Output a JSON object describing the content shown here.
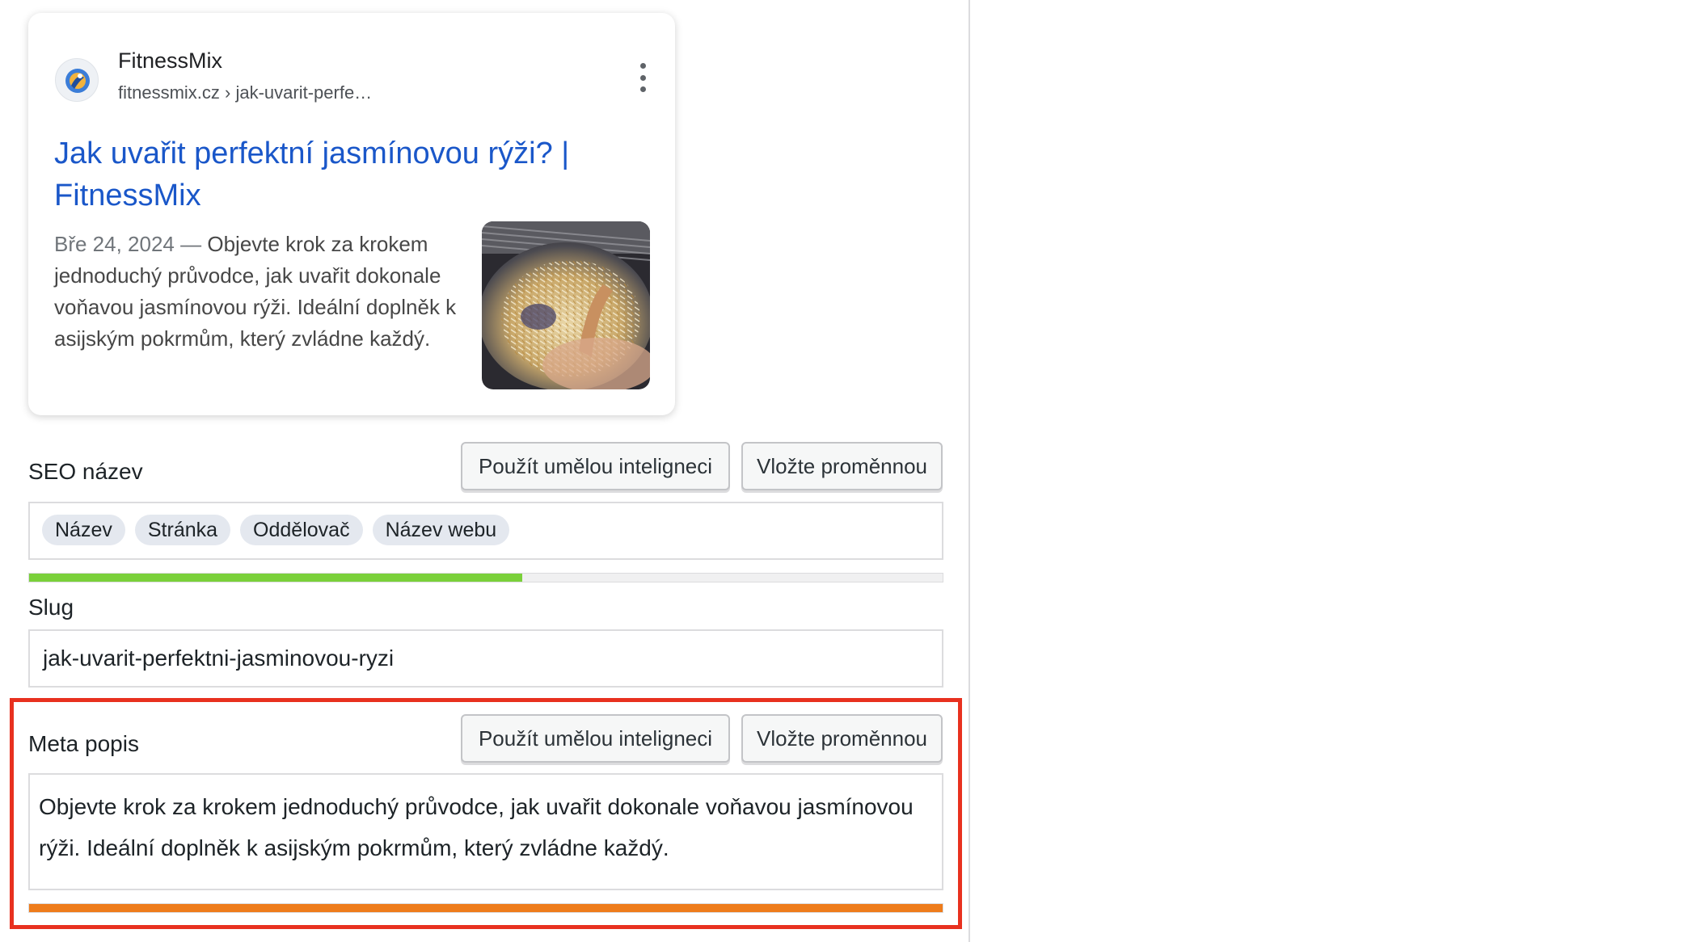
{
  "preview": {
    "site_name": "FitnessMix",
    "site_url": "fitnessmix.cz › jak-uvarit-perfe…",
    "title": "Jak uvařit perfektní jasmínovou rýži? | FitnessMix",
    "date": "Bře 24, 2024",
    "separator": "—",
    "snippet": "Objevte krok za krokem jednoduchý průvodce, jak uvařit dokonale voňavou jasmínovou rýži. Ideální doplněk k asijským pokrmům, který zvládne každý."
  },
  "seo_title": {
    "label": "SEO název",
    "ai_button": "Použít umělou inteligneci",
    "variable_button": "Vložte proměnnou",
    "chips": [
      "Název",
      "Stránka",
      "Oddělovač",
      "Název webu"
    ],
    "progress": 0.54,
    "progress_color": "#7ad03a"
  },
  "slug": {
    "label": "Slug",
    "value": "jak-uvarit-perfektni-jasminovou-ryzi"
  },
  "meta_description": {
    "label": "Meta popis",
    "ai_button": "Použít umělou inteligneci",
    "variable_button": "Vložte proměnnou",
    "value": "Objevte krok za krokem jednoduchý průvodce, jak uvařit dokonale voňavou jasmínovou rýži. Ideální doplněk k asijským pokrmům, který zvládne každý.",
    "progress": 1.0,
    "progress_color": "#ee7c1b",
    "highlight_color": "#e8311f"
  },
  "icons": {
    "kebab": "more-vert-icon",
    "favicon": "fitnessmix-logo-icon"
  }
}
